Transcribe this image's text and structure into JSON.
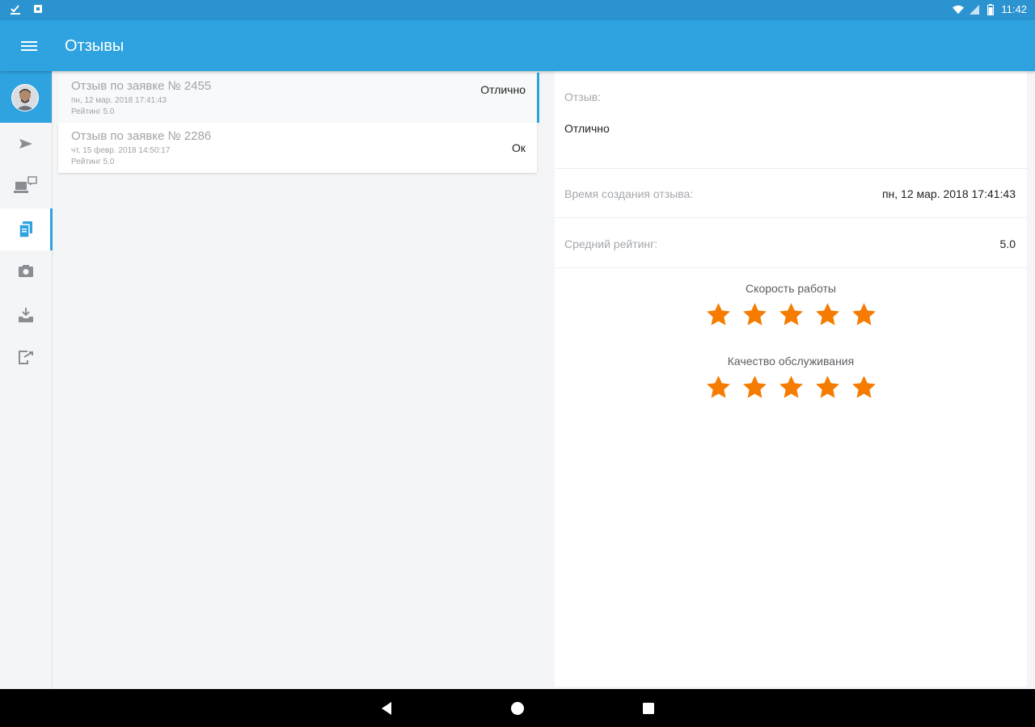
{
  "status_bar": {
    "time": "11:42"
  },
  "app_bar": {
    "title": "Отзывы"
  },
  "colors": {
    "accent": "#2ea3df",
    "status_bar": "#2b93cf",
    "star": "#f57c00"
  },
  "sidebar": {
    "items": [
      {
        "icon": "avatar"
      },
      {
        "icon": "send-icon"
      },
      {
        "icon": "computer-chat-icon"
      },
      {
        "icon": "documents-icon",
        "active": true
      },
      {
        "icon": "camera-box-icon"
      },
      {
        "icon": "inbox-download-icon"
      },
      {
        "icon": "exit-icon"
      }
    ]
  },
  "reviews": [
    {
      "title": "Отзыв по заявке № 2455",
      "date": "пн, 12 мар. 2018 17:41:43",
      "rating": "Рейтинг 5.0",
      "value": "Отлично",
      "selected": true
    },
    {
      "title": "Отзыв по заявке № 2286",
      "date": "чт, 15 февр. 2018 14:50:17",
      "rating": "Рейтинг 5.0",
      "value": "Ок",
      "selected": false
    }
  ],
  "detail": {
    "review_label": "Отзыв:",
    "review_text": "Отлично",
    "created_label": "Время создания отзыва:",
    "created_value": "пн, 12 мар. 2018 17:41:43",
    "avg_label": "Средний рейтинг:",
    "avg_value": "5.0",
    "ratings": [
      {
        "title": "Скорость работы",
        "stars": 5,
        "max": 5
      },
      {
        "title": "Качество обслуживания",
        "stars": 5,
        "max": 5
      }
    ]
  }
}
